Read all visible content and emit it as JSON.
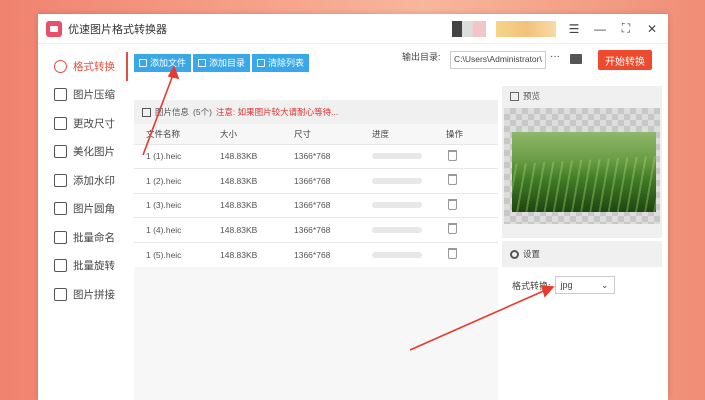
{
  "app": {
    "title": "优速图片格式转换器",
    "accent": "#e05040"
  },
  "window_controls": [
    "menu-icon",
    "minimize-icon",
    "maximize-icon",
    "close-icon"
  ],
  "sidebar": {
    "items": [
      {
        "label": "格式转换",
        "icon": "format-convert-icon",
        "active": true
      },
      {
        "label": "图片压缩",
        "icon": "compress-icon"
      },
      {
        "label": "更改尺寸",
        "icon": "resize-icon"
      },
      {
        "label": "美化图片",
        "icon": "beautify-icon"
      },
      {
        "label": "添加水印",
        "icon": "watermark-icon"
      },
      {
        "label": "图片圆角",
        "icon": "round-corner-icon"
      },
      {
        "label": "批量命名",
        "icon": "rename-icon"
      },
      {
        "label": "批量旋转",
        "icon": "rotate-icon"
      },
      {
        "label": "图片拼接",
        "icon": "stitch-icon"
      }
    ]
  },
  "toolbar": {
    "add_file": "添加文件",
    "add_dir": "添加目录",
    "clear_list": "清除列表"
  },
  "output": {
    "label": "输出目录:",
    "path": "C:\\Users\\Administrator\\",
    "more": "···"
  },
  "start_button": "开始转换",
  "files": {
    "info_label": "图片信息",
    "count": "(5个)",
    "warning": "注意: 如果图片较大请耐心等待...",
    "columns": [
      "文件名称",
      "大小",
      "尺寸",
      "进度",
      "操作"
    ],
    "rows": [
      {
        "name": "1 (1).heic",
        "size": "148.83KB",
        "dim": "1366*768",
        "progress": 0
      },
      {
        "name": "1 (2).heic",
        "size": "148.83KB",
        "dim": "1366*768",
        "progress": 0
      },
      {
        "name": "1 (3).heic",
        "size": "148.83KB",
        "dim": "1366*768",
        "progress": 0
      },
      {
        "name": "1 (4).heic",
        "size": "148.83KB",
        "dim": "1366*768",
        "progress": 0
      },
      {
        "name": "1 (5).heic",
        "size": "148.83KB",
        "dim": "1366*768",
        "progress": 0
      }
    ]
  },
  "preview": {
    "label": "预览"
  },
  "settings": {
    "label": "设置",
    "format_label": "格式转换:",
    "format_value": "jpg"
  }
}
